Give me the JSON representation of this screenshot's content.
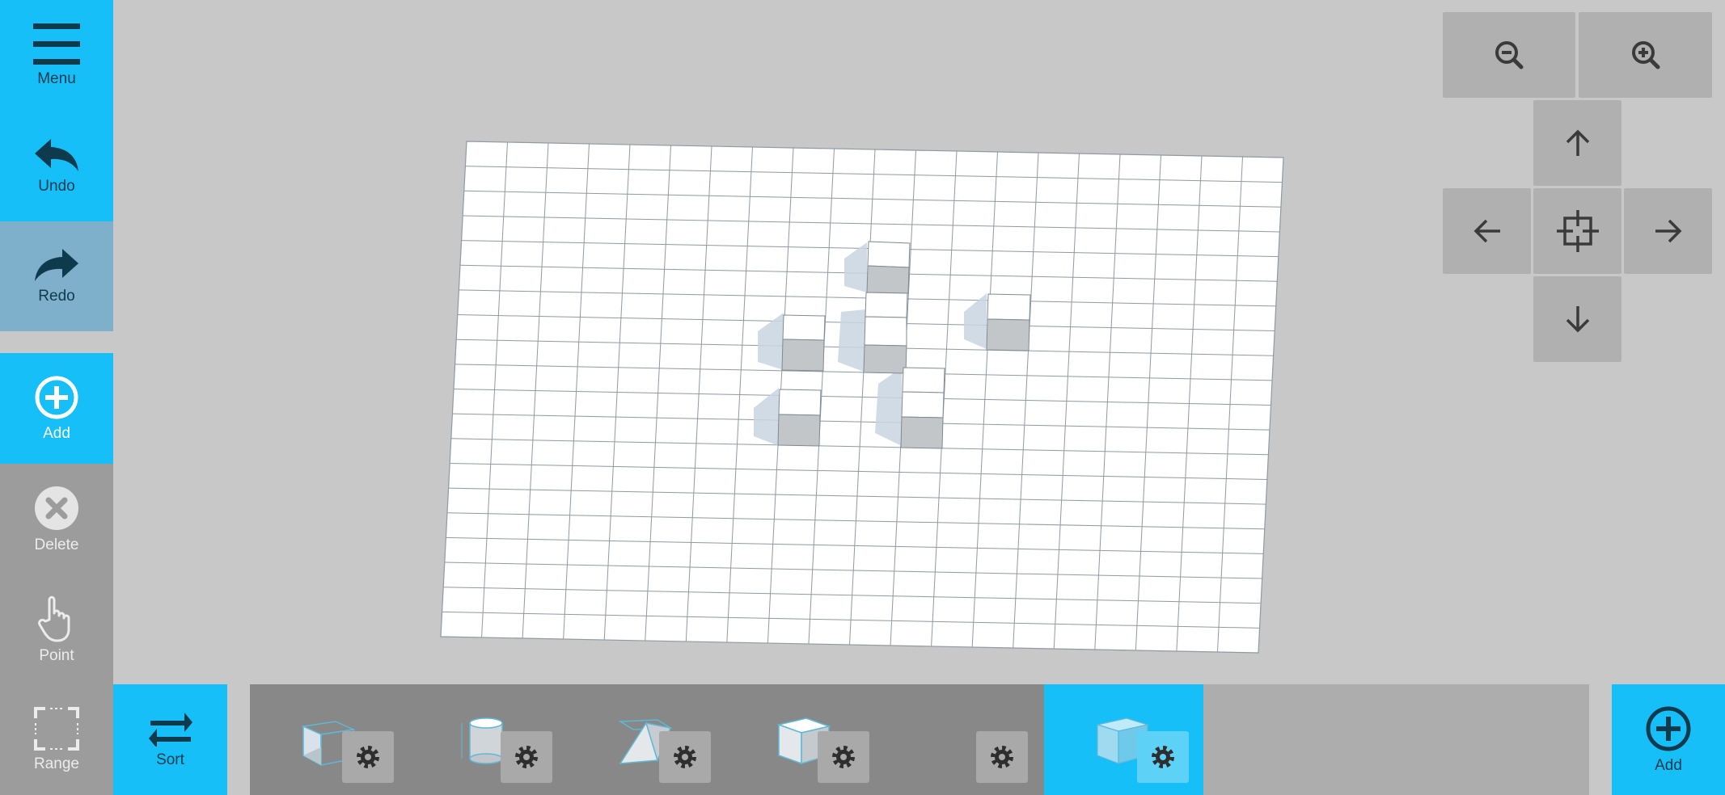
{
  "sidebar": {
    "menu": "Menu",
    "undo": "Undo",
    "redo": "Redo",
    "add": "Add",
    "delete": "Delete",
    "point": "Point",
    "range": "Range"
  },
  "bottom": {
    "sort": "Sort",
    "add": "Add",
    "shapes": [
      "cube-wire-icon",
      "cylinder-icon",
      "prism-icon",
      "wedge-cube-icon",
      "empty-slot",
      "cube-selected-icon"
    ]
  },
  "nav": {
    "zoom_out": "zoom-out-icon",
    "zoom_in": "zoom-in-icon",
    "up": "arrow-up-icon",
    "left": "arrow-left-icon",
    "center": "center-icon",
    "right": "arrow-right-icon",
    "down": "arrow-down-icon"
  },
  "colors": {
    "accent": "#16bff7",
    "redo": "#7fb0cb",
    "sidebar_gray": "#9c9c9c",
    "background": "#c8c8c8"
  }
}
